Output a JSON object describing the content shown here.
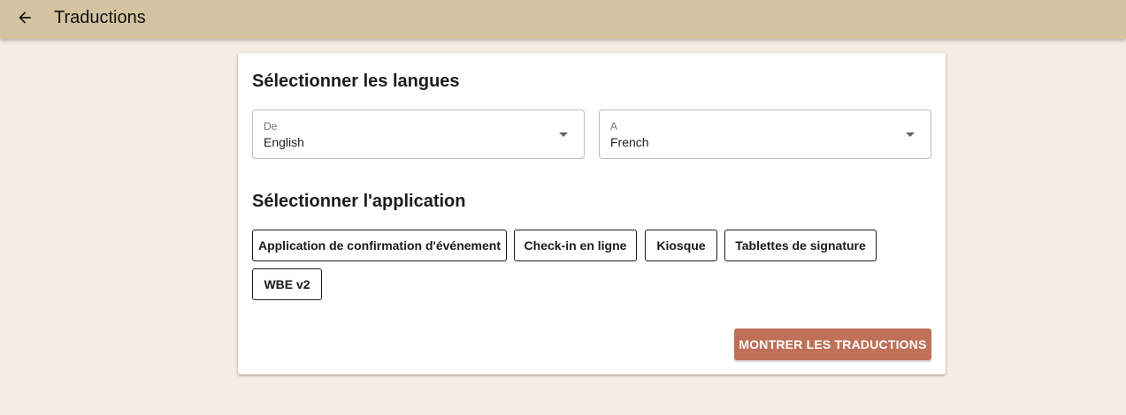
{
  "header": {
    "title": "Traductions",
    "back_icon": "arrow-left-icon",
    "background_color": "#d4c3a0"
  },
  "languages": {
    "section_title": "Sélectionner les langues",
    "from": {
      "label": "De",
      "value": "English"
    },
    "to": {
      "label": "A",
      "value": "French"
    }
  },
  "applications": {
    "section_title": "Sélectionner l'application",
    "items": [
      "Application de confirmation d'événement",
      "Check-in en ligne",
      "Kiosque",
      "Tablettes de signature",
      "WBE v2"
    ]
  },
  "actions": {
    "show_translations_label": "MONTRER LES TRADUCTIONS",
    "primary_color": "#c07058"
  },
  "page": {
    "background_color": "#f5ece2"
  }
}
